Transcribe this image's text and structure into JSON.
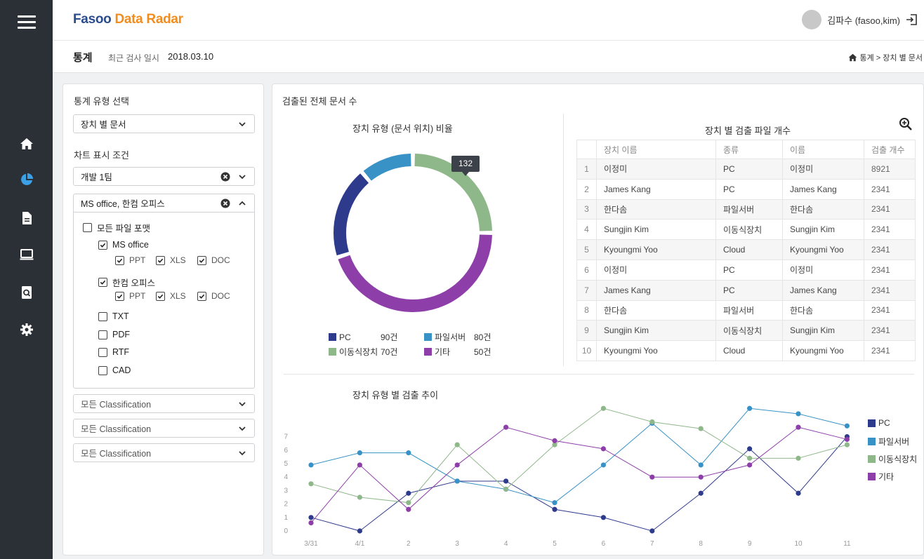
{
  "app": {
    "brand_part1": "Fasoo",
    "brand_part2": "Data Radar",
    "user_name": "김파수 (fasoo,kim)"
  },
  "colors": {
    "sidebar_bg": "#2b2f36",
    "accent_blue": "#3ba0e6",
    "pc": "#2e3a8c",
    "fileserver": "#3892c6",
    "mobile": "#8fb88a",
    "etc": "#8e3ea8"
  },
  "sidebar": {
    "items": [
      {
        "icon": "home-icon",
        "active": false
      },
      {
        "icon": "pie-chart-icon",
        "active": true
      },
      {
        "icon": "document-icon",
        "active": false
      },
      {
        "icon": "monitor-icon",
        "active": false
      },
      {
        "icon": "search-document-icon",
        "active": false
      },
      {
        "icon": "gear-icon",
        "active": false
      }
    ]
  },
  "header": {
    "title": "통계",
    "last_scan_label": "최근 검사 일시",
    "last_scan_date": "2018.03.10",
    "breadcrumb": "통계 > 장치 별 문서"
  },
  "left_panel": {
    "stat_type_label": "통계 유형 선택",
    "stat_type_value": "장치 별 문서",
    "chart_cond_label": "차트 표시 조건",
    "team_value": "개발 1팀",
    "format_value": "MS office, 한컴 오피스",
    "all_formats": "모든 파일 포맷",
    "ms_office": "MS office",
    "hancom": "한컴 오피스",
    "ppt": "PPT",
    "xls": "XLS",
    "doc": "DOC",
    "others": [
      "TXT",
      "PDF",
      "RTF",
      "CAD"
    ],
    "classification_1": "모든 Classification",
    "classification_2": "모든 Classification",
    "classification_3": "모든 Classification"
  },
  "right_panel": {
    "title": "검출된 전체 문서 수",
    "donut_title": "장치 유형 (문서 위치) 비율",
    "tooltip": "132",
    "legend": [
      {
        "name": "PC",
        "value": "90건"
      },
      {
        "name": "파일서버",
        "value": "80건"
      },
      {
        "name": "이동식장치",
        "value": "70건"
      },
      {
        "name": "기타",
        "value": "50건"
      }
    ],
    "table_title": "장치 별 검출 파일 개수",
    "table_headers": [
      "장치 이름",
      "종류",
      "이름",
      "검출 개수"
    ],
    "table_rows": [
      [
        "1",
        "이정미",
        "PC",
        "이정미",
        "8921"
      ],
      [
        "2",
        "James Kang",
        "PC",
        "James Kang",
        "2341"
      ],
      [
        "3",
        "한다솜",
        "파일서버",
        "한다솜",
        "2341"
      ],
      [
        "4",
        "Sungjin Kim",
        "이동식장치",
        "Sungjin Kim",
        "2341"
      ],
      [
        "5",
        "Kyoungmi Yoo",
        "Cloud",
        "Kyoungmi Yoo",
        "2341"
      ],
      [
        "6",
        "이정미",
        "PC",
        "이정미",
        "2341"
      ],
      [
        "7",
        "James Kang",
        "PC",
        "James Kang",
        "2341"
      ],
      [
        "8",
        "한다솜",
        "파일서버",
        "한다솜",
        "2341"
      ],
      [
        "9",
        "Sungjin Kim",
        "이동식장치",
        "Sungjin Kim",
        "2341"
      ],
      [
        "10",
        "Kyoungmi Yoo",
        "Cloud",
        "Kyoungmi Yoo",
        "2341"
      ]
    ],
    "line_title": "장치 유형 별 검출 추이"
  },
  "chart_data": [
    {
      "type": "pie",
      "title": "장치 유형 (문서 위치) 비율",
      "categories": [
        "PC",
        "파일서버",
        "이동식장치",
        "기타"
      ],
      "values": [
        90,
        80,
        70,
        50
      ],
      "value_labels": [
        "90건",
        "80건",
        "70건",
        "50건"
      ],
      "visual_arcs_deg": {
        "이동식장치": [
          0,
          90
        ],
        "기타": [
          90,
          252
        ],
        "PC": [
          252,
          320
        ],
        "파일서버": [
          320,
          360
        ]
      },
      "tooltip": "132"
    },
    {
      "type": "line",
      "title": "장치 유형 별 검출 추이",
      "categories": [
        "3/31",
        "4/1",
        "2",
        "3",
        "4",
        "5",
        "6",
        "7",
        "8",
        "9",
        "10",
        "11"
      ],
      "ylim": [
        0,
        7
      ],
      "yticks": [
        0,
        1,
        2,
        3,
        4,
        5,
        6,
        7
      ],
      "series": [
        {
          "name": "PC",
          "values": [
            1.0,
            0.0,
            2.8,
            3.7,
            3.7,
            1.6,
            1.0,
            0.0,
            2.8,
            6.1,
            2.8,
            7.0
          ]
        },
        {
          "name": "파일서버",
          "values": [
            4.9,
            5.8,
            5.8,
            3.7,
            3.1,
            2.1,
            4.9,
            8.0,
            4.9,
            9.1,
            8.7,
            7.8
          ]
        },
        {
          "name": "이동식장치",
          "values": [
            3.5,
            2.5,
            2.1,
            6.4,
            3.1,
            6.4,
            9.1,
            8.1,
            7.6,
            5.4,
            5.4,
            6.4
          ]
        },
        {
          "name": "기타",
          "values": [
            0.6,
            4.9,
            1.6,
            4.9,
            7.7,
            6.7,
            6.1,
            4.0,
            4.0,
            4.9,
            7.7,
            6.8
          ]
        }
      ]
    }
  ]
}
